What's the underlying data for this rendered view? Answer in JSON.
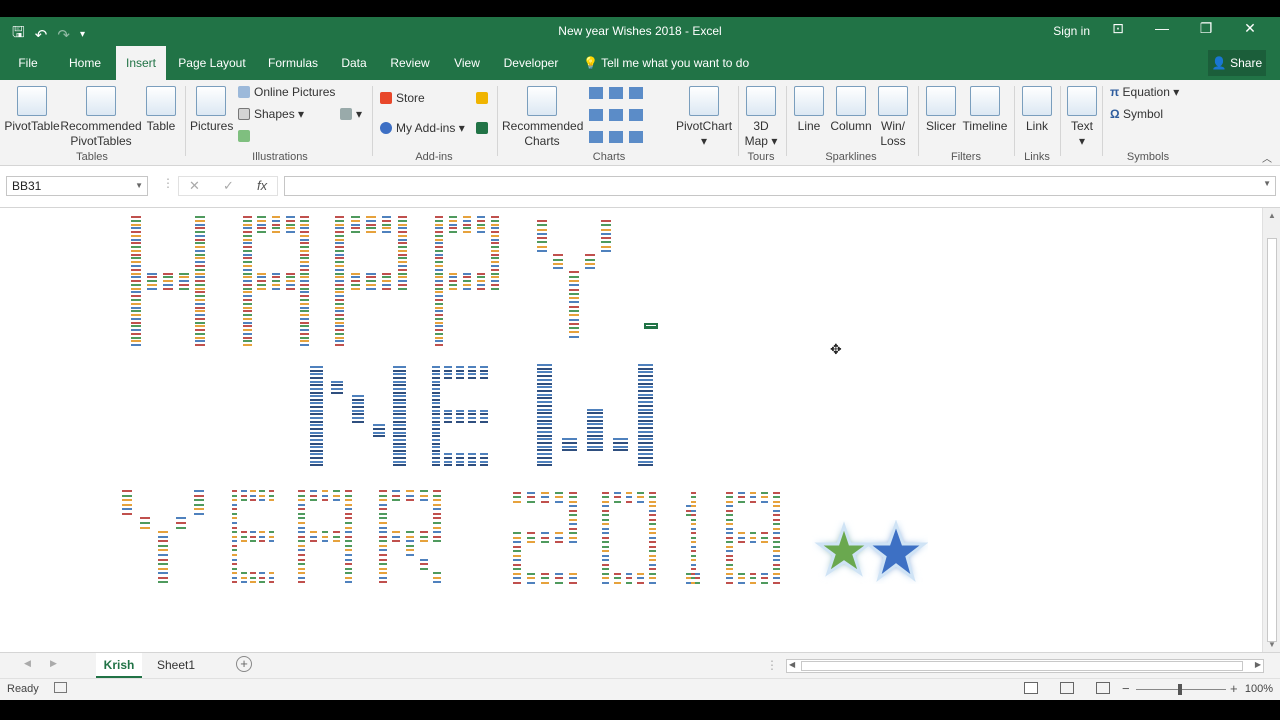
{
  "window": {
    "title": "New year Wishes 2018  -  Excel",
    "sign_in": "Sign in"
  },
  "tabs": [
    {
      "label": "File"
    },
    {
      "label": "Home"
    },
    {
      "label": "Insert"
    },
    {
      "label": "Page Layout"
    },
    {
      "label": "Formulas"
    },
    {
      "label": "Data"
    },
    {
      "label": "Review"
    },
    {
      "label": "View"
    },
    {
      "label": "Developer"
    }
  ],
  "active_tab": "Insert",
  "tell_me": "Tell me what you want to do",
  "share": "Share",
  "ribbon": {
    "tables": {
      "group": "Tables",
      "pivottable": "PivotTable",
      "recommended_pivottables": [
        "Recommended",
        "PivotTables"
      ],
      "table": "Table"
    },
    "illustrations": {
      "group": "Illustrations",
      "pictures": "Pictures",
      "online_pictures": "Online Pictures",
      "shapes": "Shapes"
    },
    "addins": {
      "group": "Add-ins",
      "store": "Store",
      "my_addins": "My Add-ins"
    },
    "charts": {
      "group": "Charts",
      "recommended_charts": [
        "Recommended",
        "Charts"
      ],
      "pivotchart": "PivotChart"
    },
    "tours": {
      "group": "Tours",
      "map": [
        "3D",
        "Map"
      ]
    },
    "sparklines": {
      "group": "Sparklines",
      "line": "Line",
      "column": "Column",
      "winloss": [
        "Win/",
        "Loss"
      ]
    },
    "filters": {
      "group": "Filters",
      "slicer": "Slicer",
      "timeline": "Timeline"
    },
    "links": {
      "group": "Links",
      "link": "Link"
    },
    "text": {
      "text": "Text"
    },
    "symbols": {
      "group": "Symbols",
      "equation": "Equation",
      "symbol": "Symbol"
    }
  },
  "formula_bar": {
    "name_box": "BB31",
    "fx": "fx",
    "formula": ""
  },
  "sheets": [
    {
      "label": "Krish"
    },
    {
      "label": "Sheet1"
    }
  ],
  "active_sheet": "Krish",
  "status": {
    "ready": "Ready",
    "zoom": "100%"
  },
  "colors": {
    "excel_green": "#217346",
    "star_green": "#6aa84f",
    "star_blue": "#3d6fc4",
    "art_red": "#c0504d",
    "art_green": "#4f9a5d",
    "art_orange": "#e6a23c",
    "art_blue": "#4f81bd",
    "art_navy": "#2f4f7f"
  }
}
